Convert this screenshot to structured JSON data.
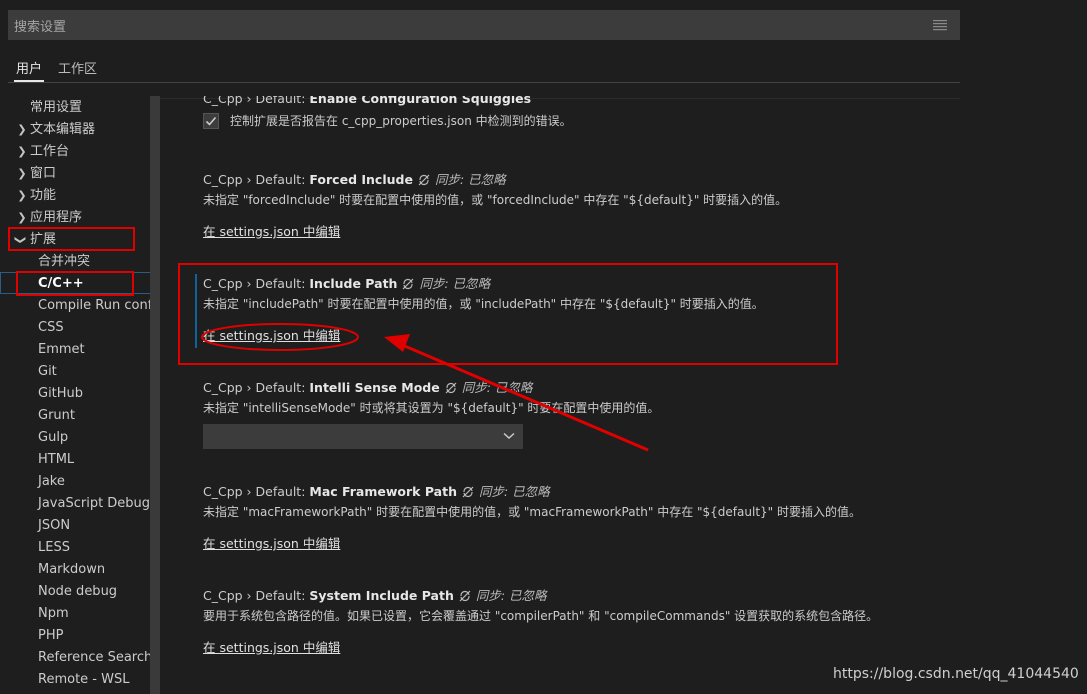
{
  "search": {
    "placeholder": "搜索设置",
    "filter_icon": "filter-list-icon"
  },
  "tabs": [
    {
      "label": "用户"
    },
    {
      "label": "工作区"
    }
  ],
  "sidebar": {
    "top": [
      {
        "label": "常用设置"
      },
      {
        "label": "文本编辑器"
      },
      {
        "label": "工作台"
      },
      {
        "label": "窗口"
      },
      {
        "label": "功能"
      },
      {
        "label": "应用程序"
      },
      {
        "label": "扩展"
      }
    ],
    "extensions": [
      "合并冲突",
      "C/C++",
      "Compile Run confi...",
      "CSS",
      "Emmet",
      "Git",
      "GitHub",
      "Grunt",
      "Gulp",
      "HTML",
      "Jake",
      "JavaScript Debugger",
      "JSON",
      "LESS",
      "Markdown",
      "Node debug",
      "Npm",
      "PHP",
      "Reference Search V...",
      "Remote - WSL"
    ]
  },
  "settings": {
    "squiggles": {
      "prefix": "C_Cpp › Default: ",
      "name": "Enable Configuration Squiggles",
      "desc": "控制扩展是否报告在 c_cpp_properties.json 中检测到的错误。"
    },
    "forced_include": {
      "prefix": "C_Cpp › Default: ",
      "name": "Forced Include",
      "sync": "同步: 已忽略",
      "desc": "未指定 \"forcedInclude\" 时要在配置中使用的值，或 \"forcedInclude\" 中存在 \"${default}\" 时要插入的值。",
      "link": "在 settings.json 中编辑"
    },
    "include_path": {
      "prefix": "C_Cpp › Default: ",
      "name": "Include Path",
      "sync": "同步: 已忽略",
      "desc": "未指定 \"includePath\" 时要在配置中使用的值，或 \"includePath\" 中存在 \"${default}\" 时要插入的值。",
      "link": "在 settings.json 中编辑"
    },
    "intelli_sense": {
      "prefix": "C_Cpp › Default: ",
      "name": "Intelli Sense Mode",
      "sync": "同步: 已忽略",
      "desc": "未指定 \"intelliSenseMode\" 时或将其设置为 \"${default}\" 时要在配置中使用的值。",
      "value": ""
    },
    "mac_framework": {
      "prefix": "C_Cpp › Default: ",
      "name": "Mac Framework Path",
      "sync": "同步: 已忽略",
      "desc": "未指定 \"macFrameworkPath\" 时要在配置中使用的值，或 \"macFrameworkPath\" 中存在 \"${default}\" 时要插入的值。",
      "link": "在 settings.json 中编辑"
    },
    "system_include": {
      "prefix": "C_Cpp › Default: ",
      "name": "System Include Path",
      "sync": "同步: 已忽略",
      "desc": "要用于系统包含路径的值。如果已设置，它会覆盖通过 \"compilerPath\" 和 \"compileCommands\" 设置获取的系统包含路径。",
      "link": "在 settings.json 中编辑"
    }
  },
  "watermark": "https://blog.csdn.net/qq_41044540",
  "colors": {
    "annotation": "#e00000",
    "focus": "#0e639c"
  }
}
